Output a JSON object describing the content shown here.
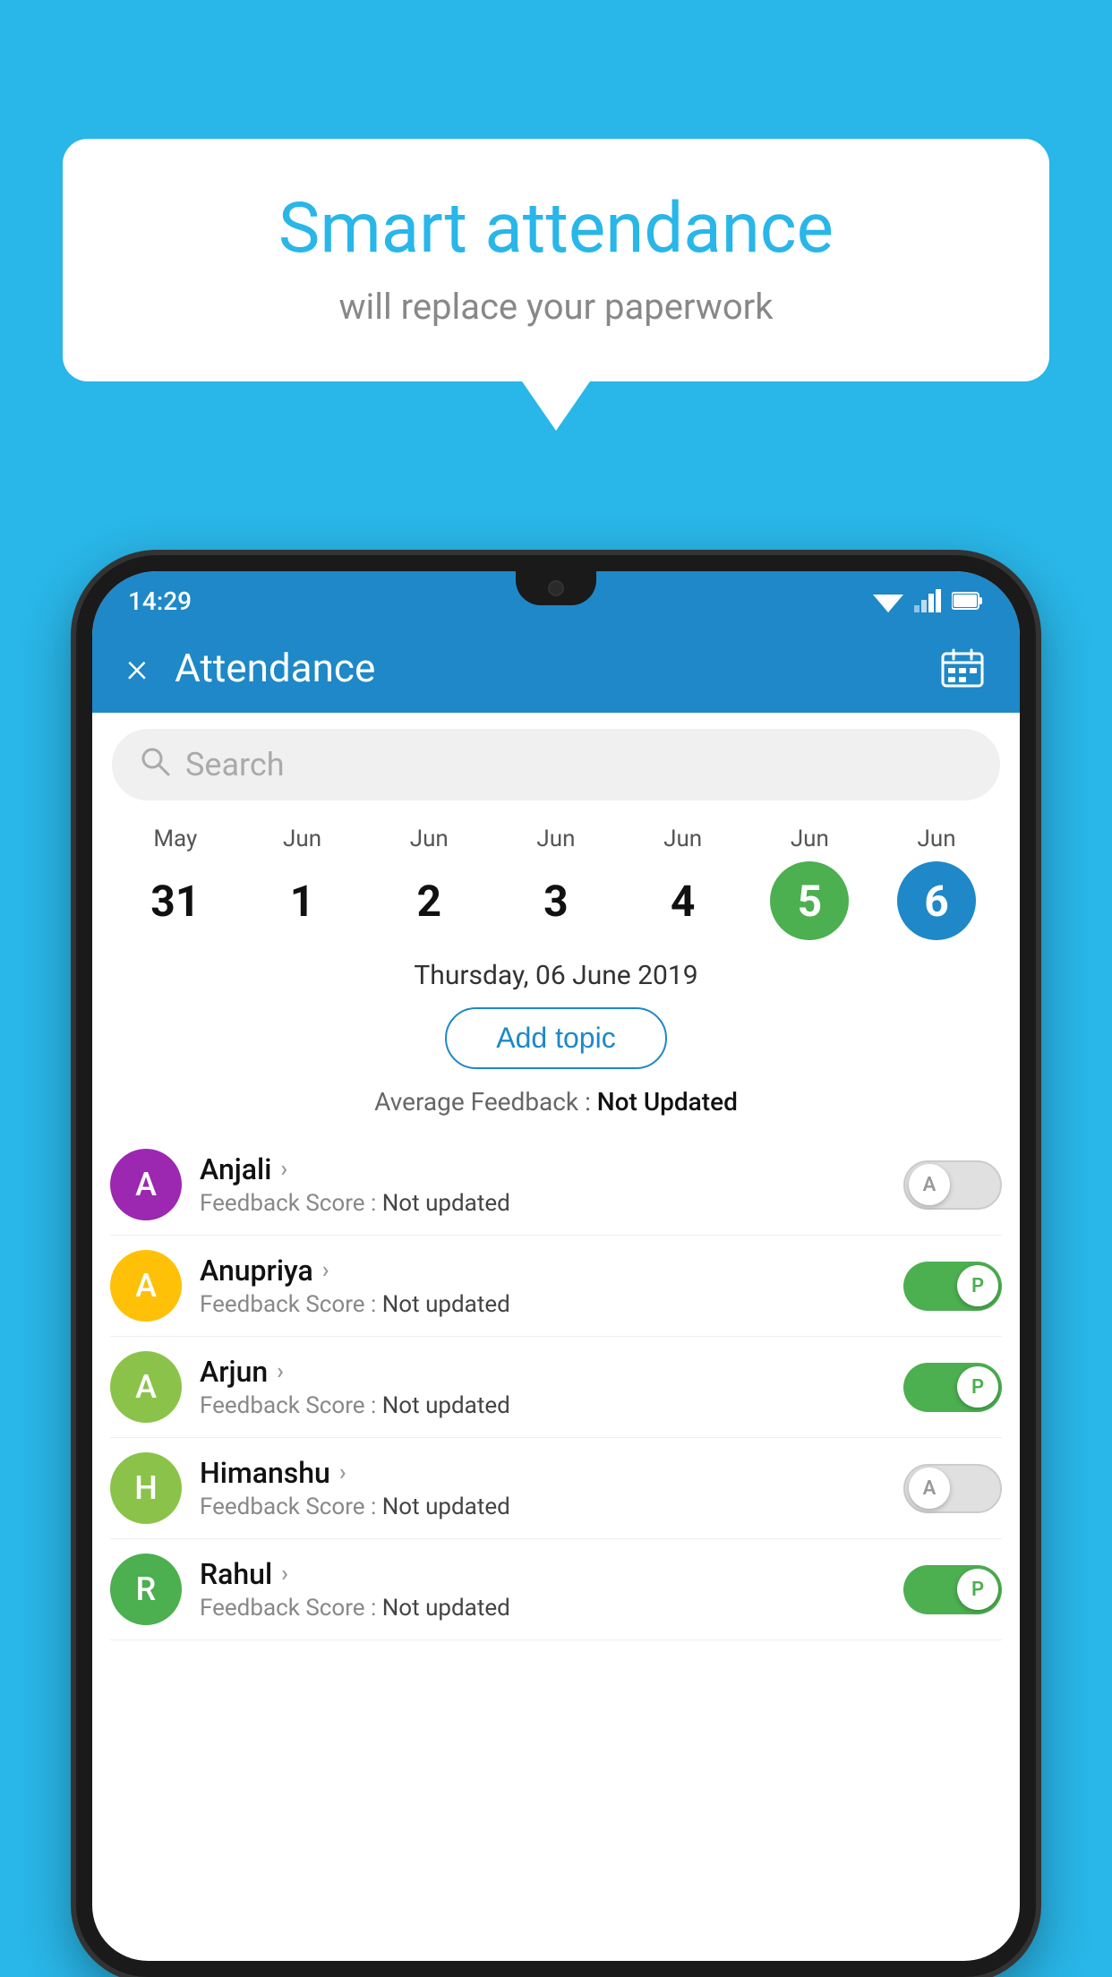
{
  "background_color": "#29B6E8",
  "bubble": {
    "title": "Smart attendance",
    "subtitle": "will replace your paperwork"
  },
  "status_bar": {
    "time": "14:29"
  },
  "header": {
    "title": "Attendance",
    "close_label": "×",
    "calendar_icon": "calendar-icon"
  },
  "search": {
    "placeholder": "Search"
  },
  "calendar": {
    "days": [
      {
        "month": "May",
        "date": "31",
        "state": "normal"
      },
      {
        "month": "Jun",
        "date": "1",
        "state": "normal"
      },
      {
        "month": "Jun",
        "date": "2",
        "state": "normal"
      },
      {
        "month": "Jun",
        "date": "3",
        "state": "normal"
      },
      {
        "month": "Jun",
        "date": "4",
        "state": "normal"
      },
      {
        "month": "Jun",
        "date": "5",
        "state": "today"
      },
      {
        "month": "Jun",
        "date": "6",
        "state": "selected"
      }
    ],
    "selected_date_label": "Thursday, 06 June 2019"
  },
  "add_topic_label": "Add topic",
  "avg_feedback": {
    "label": "Average Feedback : ",
    "value": "Not Updated"
  },
  "students": [
    {
      "name": "Anjali",
      "avatar_letter": "A",
      "avatar_color": "#9C27B0",
      "feedback_label": "Feedback Score : ",
      "feedback_value": "Not updated",
      "toggle_state": "off",
      "toggle_letter": "A"
    },
    {
      "name": "Anupriya",
      "avatar_letter": "A",
      "avatar_color": "#FFC107",
      "feedback_label": "Feedback Score : ",
      "feedback_value": "Not updated",
      "toggle_state": "on",
      "toggle_letter": "P"
    },
    {
      "name": "Arjun",
      "avatar_letter": "A",
      "avatar_color": "#8BC34A",
      "feedback_label": "Feedback Score : ",
      "feedback_value": "Not updated",
      "toggle_state": "on",
      "toggle_letter": "P"
    },
    {
      "name": "Himanshu",
      "avatar_letter": "H",
      "avatar_color": "#8BC34A",
      "feedback_label": "Feedback Score : ",
      "feedback_value": "Not updated",
      "toggle_state": "off",
      "toggle_letter": "A"
    },
    {
      "name": "Rahul",
      "avatar_letter": "R",
      "avatar_color": "#4CAF50",
      "feedback_label": "Feedback Score : ",
      "feedback_value": "Not updated",
      "toggle_state": "on",
      "toggle_letter": "P"
    }
  ]
}
